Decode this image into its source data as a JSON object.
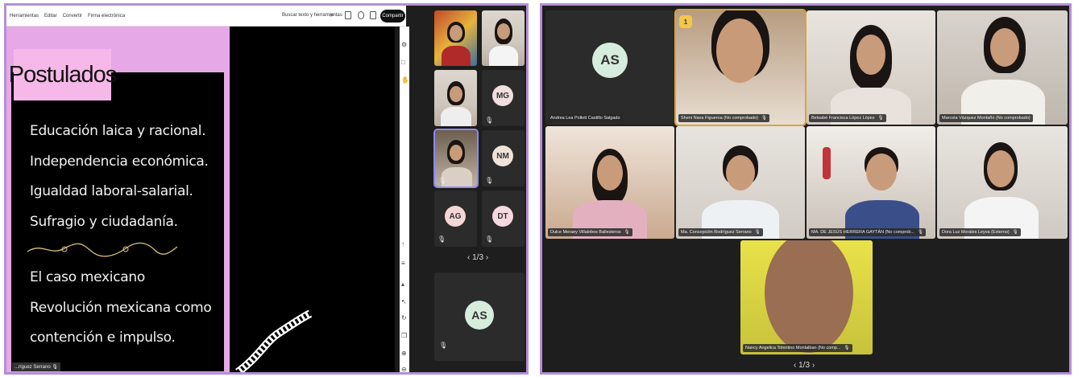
{
  "left_window": {
    "menu": [
      "Herramientas",
      "Editar",
      "Convertir",
      "Firma electrónica"
    ],
    "search_label": "Buscar texto y herramientas",
    "share_label": "Compartir",
    "slide": {
      "title": "Postulados",
      "bullets": [
        "Educación laica y racional.",
        "Independencia económica.",
        "Igualdad laboral-salarial.",
        "Sufragio y ciudadanía."
      ],
      "bullets2": [
        "El caso mexicano",
        "Revolución mexicana como",
        "contención e impulso."
      ]
    },
    "presenter_name": "...ríguez Serrano",
    "gallery": {
      "avatars": [
        {
          "initials": "MG",
          "color": "#f1dede"
        },
        {
          "initials": "NM",
          "color": "#efe2d8"
        },
        {
          "initials": "AG",
          "color": "#f4d6d6"
        },
        {
          "initials": "DT",
          "color": "#f6d8df"
        }
      ],
      "pager": "1/3",
      "big_avatar": {
        "initials": "AS",
        "color": "#d6ecdc"
      }
    }
  },
  "right_window": {
    "tiles": [
      {
        "name": "Andrea Lea Pollett Castillo Salgado",
        "initials": "AS",
        "avatar_color": "#d6ecdc"
      },
      {
        "name": "Sheni Nava Figueroa (No comprobado)",
        "badge": "1"
      },
      {
        "name": "Betsabé Francisca López López"
      },
      {
        "name": "Marcela Vázquez Montaño (No comprobado)"
      },
      {
        "name": "Dulce Meraey Villalobos Ballesteros"
      },
      {
        "name": "Ma. Concepción Rodríguez Serrano"
      },
      {
        "name": "MA. DE JESÚS HERRERA GAYTÁN (No comprob..."
      },
      {
        "name": "Dora Luz Morales Leyva (Externo)"
      },
      {
        "name": "Nancy Angelica Tolentino Montalban (No comp..."
      }
    ],
    "pager": "1/3"
  },
  "colors": {
    "accent_border": "#b48fd8",
    "slide_pink": "#e6a8e6",
    "title_pink": "#f6b8e8",
    "active_speaker": "#d9a53a"
  },
  "icons": {
    "mic": "microphone-icon",
    "search": "search-icon",
    "hand": "raised-hand-icon"
  }
}
